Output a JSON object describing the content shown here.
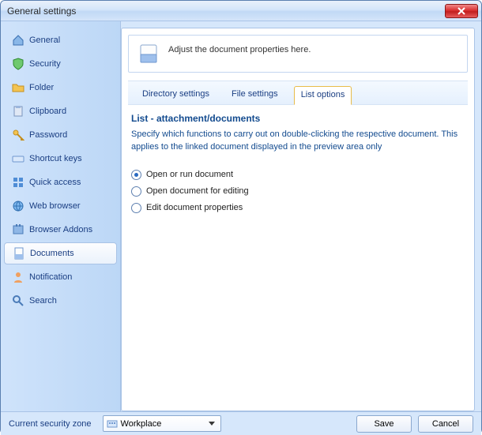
{
  "window": {
    "title": "General settings"
  },
  "sidebar": {
    "items": [
      {
        "label": "General",
        "icon": "home-icon",
        "selected": false
      },
      {
        "label": "Security",
        "icon": "shield-icon",
        "selected": false
      },
      {
        "label": "Folder",
        "icon": "folder-icon",
        "selected": false
      },
      {
        "label": "Clipboard",
        "icon": "clipboard-icon",
        "selected": false
      },
      {
        "label": "Password",
        "icon": "key-icon",
        "selected": false
      },
      {
        "label": "Shortcut keys",
        "icon": "keyboard-icon",
        "selected": false
      },
      {
        "label": "Quick access",
        "icon": "grid-icon",
        "selected": false
      },
      {
        "label": "Web browser",
        "icon": "globe-icon",
        "selected": false
      },
      {
        "label": "Browser Addons",
        "icon": "addon-icon",
        "selected": false
      },
      {
        "label": "Documents",
        "icon": "document-icon",
        "selected": true
      },
      {
        "label": "Notification",
        "icon": "user-icon",
        "selected": false
      },
      {
        "label": "Search",
        "icon": "search-icon",
        "selected": false
      }
    ]
  },
  "hint": {
    "text": "Adjust the document properties here."
  },
  "tabs": [
    {
      "label": "Directory settings",
      "active": false
    },
    {
      "label": "File settings",
      "active": false
    },
    {
      "label": "List options",
      "active": true
    }
  ],
  "section": {
    "title": "List - attachment/documents",
    "description": "Specify which functions to carry out on double-clicking the respective document. This applies to the linked document displayed in the preview area only"
  },
  "radios": [
    {
      "label": "Open or run document",
      "checked": true
    },
    {
      "label": "Open document for editing",
      "checked": false
    },
    {
      "label": "Edit document properties",
      "checked": false
    }
  ],
  "footer": {
    "zone_label": "Current security zone",
    "zone_value": "Workplace",
    "save": "Save",
    "cancel": "Cancel"
  }
}
